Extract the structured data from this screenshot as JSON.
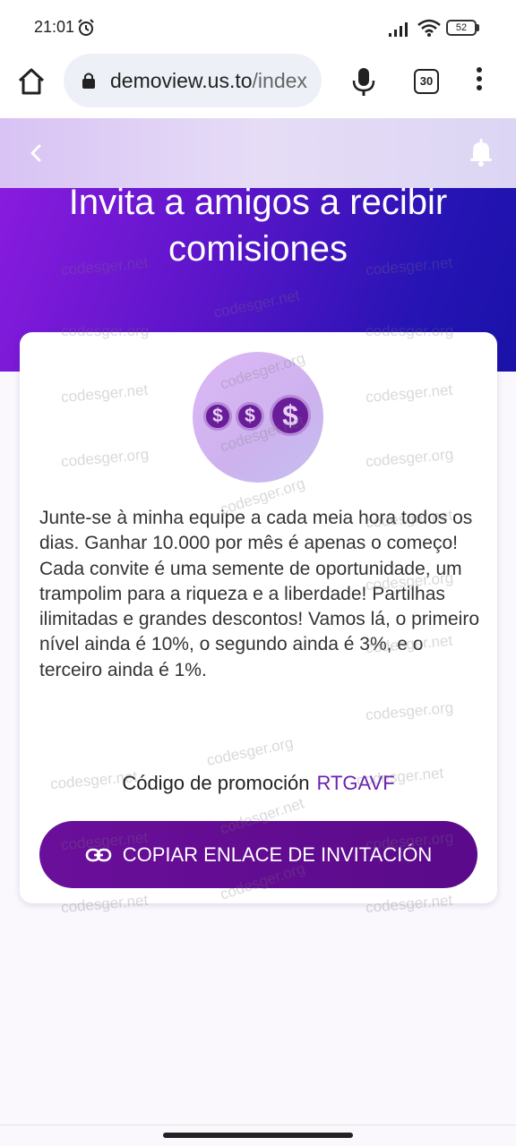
{
  "status_bar": {
    "time": "21:01",
    "battery": "52",
    "icons": [
      "alarm-icon",
      "signal-icon",
      "wifi-icon",
      "battery-icon"
    ]
  },
  "browser": {
    "url_domain": "demoview.us.to",
    "url_path": "/index",
    "tab_count": "30",
    "icons": [
      "home-icon",
      "lock-icon",
      "mic-icon",
      "more-vert-icon"
    ]
  },
  "header": {
    "icons": [
      "chevron-left-icon",
      "bell-icon"
    ],
    "title_line1": "Invita a amigos a recibir",
    "title_line2": "comisiones"
  },
  "card": {
    "coin_symbol": "$",
    "description": "Junte-se à minha equipe a cada meia hora todos os dias. Ganhar 10.000 por mês é apenas o começo! Cada convite é uma semente de oportunidade, um trampolim para a riqueza e a liberdade! Partilhas ilimitadas e grandes descontos! Vamos lá, o primeiro nível ainda é 10%, o segundo ainda é 3%, e o terceiro ainda é 1%.",
    "promo_label": "Código de promoción",
    "promo_code": "RTGAVF",
    "copy_button_label": "COPIAR ENLACE DE INVITACIÓN"
  },
  "watermarks": [
    "codesger.net",
    "codesger.org"
  ],
  "colors": {
    "hero_start": "#8e1ce0",
    "hero_end": "#1a12a8",
    "button": "#6a0f9a",
    "promo_code": "#6b21b0"
  }
}
